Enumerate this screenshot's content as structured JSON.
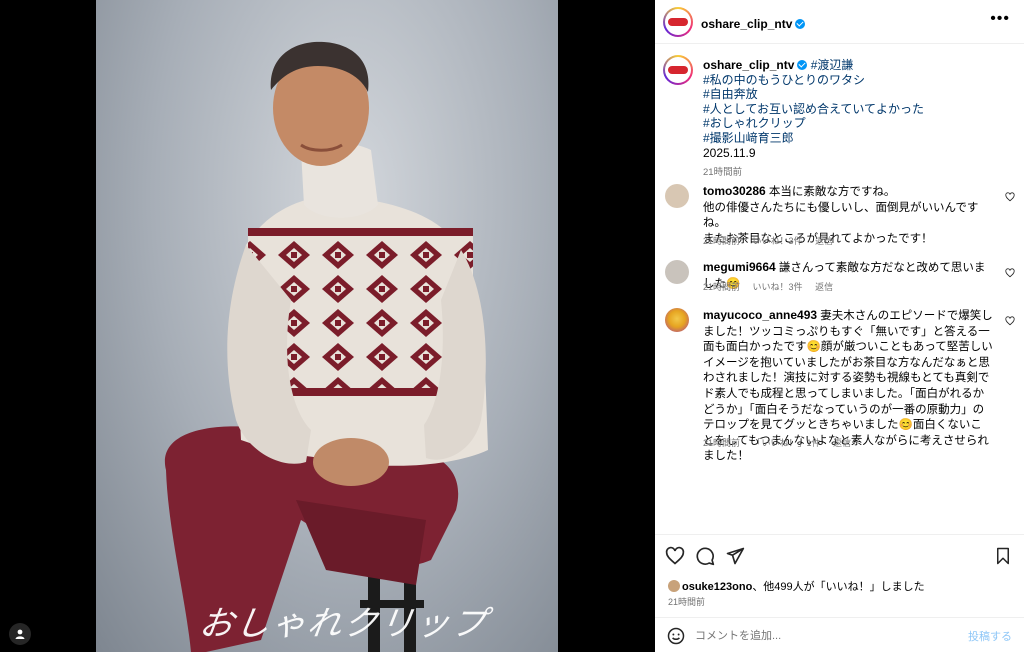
{
  "account": {
    "username": "oshare_clip_ntv",
    "verified": true
  },
  "photo": {
    "signature_text": "おしゃれクリップ"
  },
  "caption": {
    "username": "oshare_clip_ntv",
    "first_tag": "#渡辺謙",
    "tags": [
      "#私の中のもうひとりのワタシ",
      "#自由奔放",
      "#人としてお互い認め合えていてよかった",
      "#おしゃれクリップ",
      "#撮影山﨑育三郎"
    ],
    "date": "2025.11.9",
    "time_ago": "21時間前"
  },
  "comments": [
    {
      "username": "tomo30286",
      "text": "本当に素敵な方ですね。",
      "lines": [
        "他の俳優さんたちにも優しいし、面倒見がいいんですね。",
        "またお茶目なところが見れてよかったです！"
      ],
      "time": "21時間前",
      "likes": "いいね！3件",
      "reply": "返信"
    },
    {
      "username": "megumi9664",
      "text": "謙さんって素敵な方だなと改めて思いました😊",
      "lines": [],
      "time": "21時間前",
      "likes": "いいね！3件",
      "reply": "返信"
    },
    {
      "username": "mayucoco_anne493",
      "text": "妻夫木さんのエピソードで爆笑しました！ツッコミっぷりもすぐ「無いです」と答える一面も面白かったです😊顔が厳ついこともあって堅苦しいイメージを抱いていましたがお茶目な方なんだなぁと思わされました！演技に対する姿勢も視線もとても真剣でド素人でも成程と思ってしまいました。「面白がれるかどうか」「面白そうだなっていうのが一番の原動力」のテロップを見てグッときちゃいました😊面白くないことをしてもつまんないよなと素人ながらに考えさせられました！",
      "lines": [],
      "time": "21時間前",
      "likes": "「いいね！」1件",
      "reply": "返信"
    }
  ],
  "likes_line": {
    "user": "osuke123ono",
    "rest": "、他499人が「いいね！」しました"
  },
  "post_time": "21時間前",
  "comment_input": {
    "placeholder": "コメントを追加...",
    "post_label": "投稿する"
  },
  "icons": [
    "more-icon",
    "heart-icon",
    "comment-icon",
    "share-icon",
    "bookmark-icon",
    "emoji-icon",
    "user-tag-icon"
  ],
  "colors": {
    "link": "#00376b",
    "meta": "#737373",
    "verified": "#0095f6",
    "post": "#8fc7f7"
  }
}
